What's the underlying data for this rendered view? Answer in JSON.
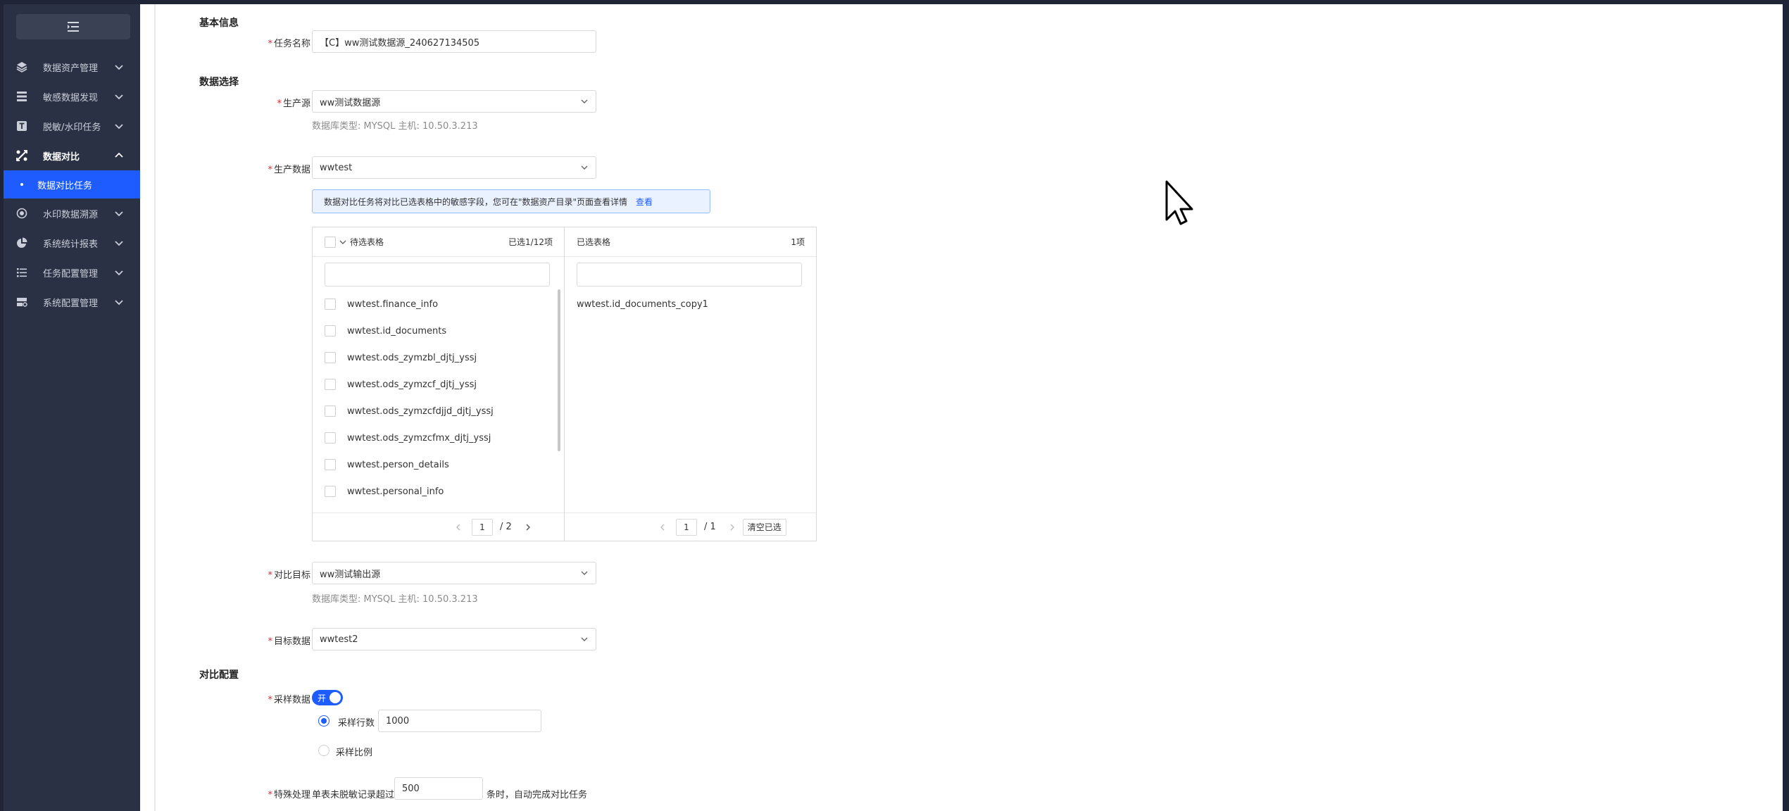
{
  "sidebar": {
    "collapse_icon": "menu-fold-icon",
    "items": [
      {
        "label": "数据资产管理",
        "icon": "layers-icon"
      },
      {
        "label": "敏感数据发现",
        "icon": "database-icon"
      },
      {
        "label": "脱敏/水印任务",
        "icon": "t-square-icon"
      },
      {
        "label": "数据对比",
        "icon": "compare-icon",
        "open": true
      },
      {
        "label": "水印数据溯源",
        "icon": "target-icon"
      },
      {
        "label": "系统统计报表",
        "icon": "pie-chart-icon"
      },
      {
        "label": "任务配置管理",
        "icon": "list-icon"
      },
      {
        "label": "系统配置管理",
        "icon": "settings-box-icon"
      }
    ],
    "active_sub": "数据对比任务"
  },
  "form": {
    "basic_title": "基本信息",
    "task_name_label": "任务名称",
    "task_name_value": "【C】ww测试数据源_240627134505",
    "data_select_title": "数据选择",
    "source_label": "生产源",
    "source_value": "ww测试数据源",
    "source_hint": "数据库类型: MYSQL    主机: 10.50.3.213",
    "source_data_label": "生产数据",
    "source_data_value": "wwtest",
    "info_text": "数据对比任务将对比已选表格中的敏感字段，您可在\"数据资产目录\"页面查看详情",
    "info_link": "查看",
    "target_label": "对比目标",
    "target_value": "ww测试输出源",
    "target_hint": "数据库类型: MYSQL    主机: 10.50.3.213",
    "target_data_label": "目标数据",
    "target_data_value": "wwtest2",
    "compare_title": "对比配置",
    "sample_label": "采样数据",
    "switch_text": "开",
    "sample_rows_label": "采样行数",
    "sample_rows_value": "1000",
    "sample_ratio_label": "采样比例",
    "special_label": "特殊处理",
    "special_prefix": "单表未脱敏记录超过",
    "special_value": "500",
    "special_suffix": "条时，自动完成对比任务"
  },
  "transfer": {
    "left_title": "待选表格",
    "left_count": "已选1/12项",
    "left_items": [
      "wwtest.finance_info",
      "wwtest.id_documents",
      "wwtest.ods_zymzbl_djtj_yssj",
      "wwtest.ods_zymzcf_djtj_yssj",
      "wwtest.ods_zymzcfdjjd_djtj_yssj",
      "wwtest.ods_zymzcfmx_djtj_yssj",
      "wwtest.person_details",
      "wwtest.personal_info"
    ],
    "left_page": "1",
    "left_total": "/  2",
    "right_title": "已选表格",
    "right_count": "1项",
    "right_items": [
      "wwtest.id_documents_copy1"
    ],
    "right_page": "1",
    "right_total": "/  1",
    "clear_label": "清空已选"
  }
}
